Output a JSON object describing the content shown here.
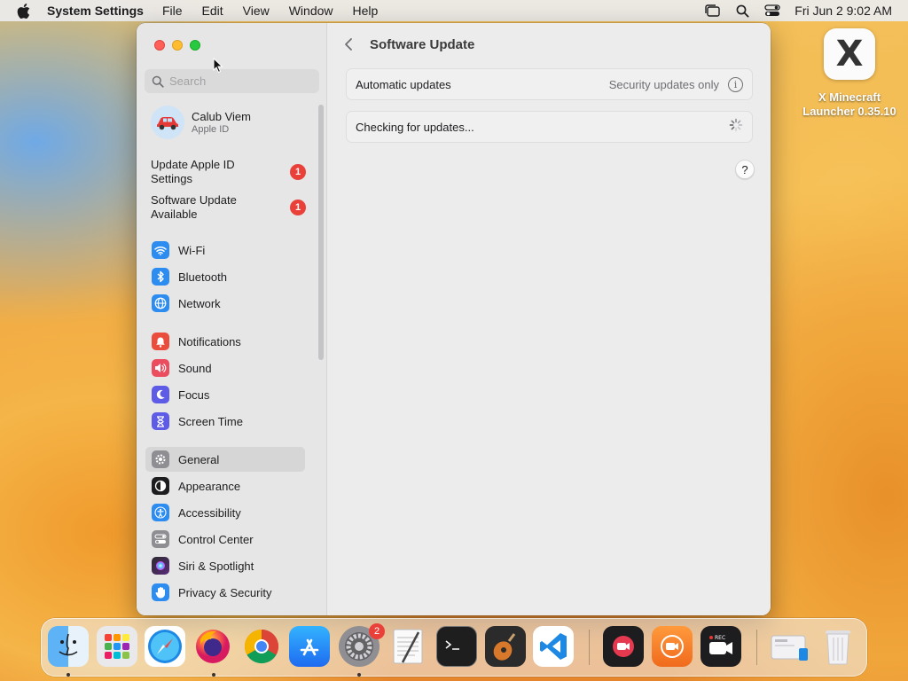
{
  "menubar": {
    "app_name": "System Settings",
    "menus": [
      "File",
      "Edit",
      "View",
      "Window",
      "Help"
    ],
    "clock": "Fri Jun 2  9:02 AM",
    "status_icons": [
      "stage-manager-icon",
      "spotlight-icon",
      "control-center-icon"
    ]
  },
  "desktop": {
    "icon_glyph": "X",
    "icon_label_line1": "X Minecraft",
    "icon_label_line2": "Launcher 0.35.10"
  },
  "sidebar": {
    "search_placeholder": "Search",
    "profile": {
      "name": "Calub Viem",
      "subtitle": "Apple ID"
    },
    "notices": [
      {
        "line1": "Update Apple ID",
        "line2": "Settings",
        "badge": "1"
      },
      {
        "line1": "Software Update",
        "line2": "Available",
        "badge": "1"
      }
    ],
    "items": [
      {
        "label": "Wi-Fi",
        "icon": "wifi-icon",
        "color": "#2d8cf0"
      },
      {
        "label": "Bluetooth",
        "icon": "bluetooth-icon",
        "color": "#2d8cf0"
      },
      {
        "label": "Network",
        "icon": "globe-icon",
        "color": "#2d8cf0"
      },
      {
        "label": "Notifications",
        "icon": "bell-icon",
        "color": "#eb4d3d"
      },
      {
        "label": "Sound",
        "icon": "speaker-icon",
        "color": "#eb4d5e"
      },
      {
        "label": "Focus",
        "icon": "moon-icon",
        "color": "#5e5ce6"
      },
      {
        "label": "Screen Time",
        "icon": "hourglass-icon",
        "color": "#5e5ce6"
      },
      {
        "label": "General",
        "icon": "gear-icon",
        "color": "#8e8e93"
      },
      {
        "label": "Appearance",
        "icon": "appearance-icon",
        "color": "#1d1d1f"
      },
      {
        "label": "Accessibility",
        "icon": "accessibility-icon",
        "color": "#2d8cf0"
      },
      {
        "label": "Control Center",
        "icon": "toggles-icon",
        "color": "#8e8e93"
      },
      {
        "label": "Siri & Spotlight",
        "icon": "siri-icon",
        "color": "#b04fd6"
      },
      {
        "label": "Privacy & Security",
        "icon": "hand-icon",
        "color": "#2d8cf0"
      }
    ],
    "selected": "General"
  },
  "main": {
    "title": "Software Update",
    "rows": [
      {
        "label": "Automatic updates",
        "value": "Security updates only"
      },
      {
        "label": "Checking for updates...",
        "value": ""
      }
    ],
    "help_label": "?"
  },
  "dock": {
    "apps": [
      "Finder",
      "Launchpad",
      "Safari",
      "Firefox",
      "Chrome",
      "App Store",
      "System Settings",
      "TextEdit",
      "Terminal",
      "GarageBand",
      "Visual Studio Code",
      "Screen Recorder",
      "Screen Recorder Pro",
      "Video Recorder",
      "Downloads",
      "Trash"
    ],
    "settings_badge": "2"
  }
}
